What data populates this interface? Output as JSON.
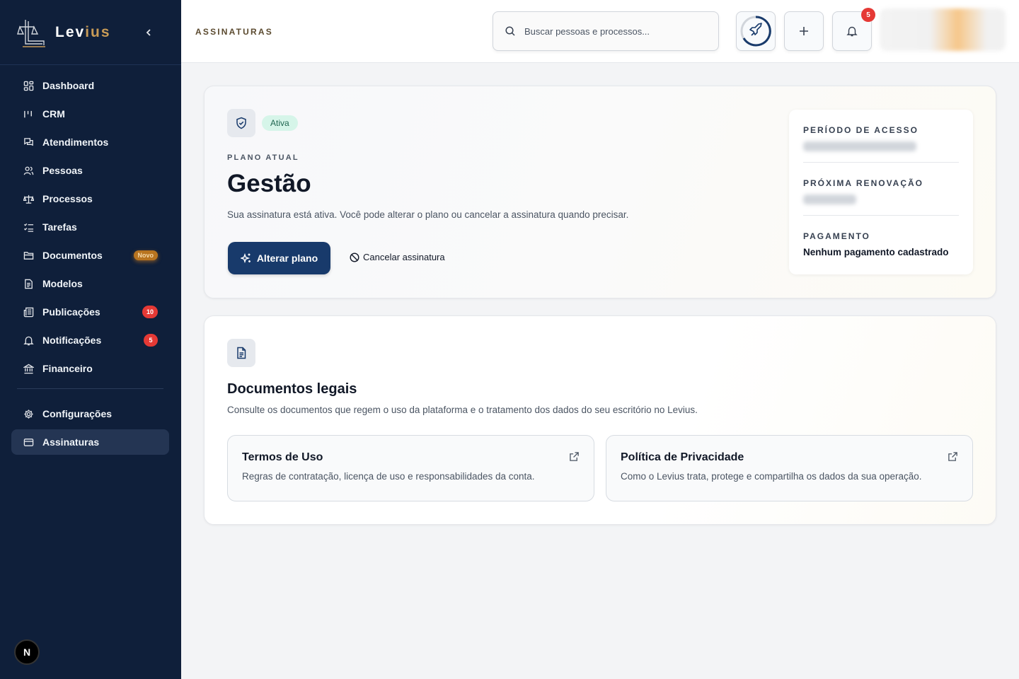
{
  "brand": {
    "name_main": "Lev",
    "name_accent": "ius"
  },
  "sidebar": {
    "items": [
      {
        "label": "Dashboard"
      },
      {
        "label": "CRM"
      },
      {
        "label": "Atendimentos"
      },
      {
        "label": "Pessoas"
      },
      {
        "label": "Processos"
      },
      {
        "label": "Tarefas"
      },
      {
        "label": "Documentos",
        "badge": "Novo"
      },
      {
        "label": "Modelos"
      },
      {
        "label": "Publicações",
        "badge": "10"
      },
      {
        "label": "Notificações",
        "badge": "5"
      },
      {
        "label": "Financeiro"
      }
    ],
    "bottom_items": [
      {
        "label": "Configurações"
      },
      {
        "label": "Assinaturas",
        "active": true
      }
    ],
    "user_initial": "N"
  },
  "topbar": {
    "breadcrumb": "ASSINATURAS",
    "search_placeholder": "Buscar pessoas e processos...",
    "notification_count": "5"
  },
  "subscription": {
    "status": "Ativa",
    "current_plan_label": "PLANO ATUAL",
    "plan_name": "Gestão",
    "description": "Sua assinatura está ativa. Você pode alterar o plano ou cancelar a assinatura quando precisar.",
    "change_plan_label": "Alterar plano",
    "cancel_label": "Cancelar assinatura",
    "access_period_label": "PERÍODO DE ACESSO",
    "renewal_label": "PRÓXIMA RENOVAÇÃO",
    "payment_label": "PAGAMENTO",
    "payment_value": "Nenhum pagamento cadastrado"
  },
  "legal": {
    "title": "Documentos legais",
    "description": "Consulte os documentos que regem o uso da plataforma e o tratamento dos dados do seu escritório no Levius.",
    "documents": [
      {
        "title": "Termos de Uso",
        "description": "Regras de contratação, licença de uso e responsabilidades da conta."
      },
      {
        "title": "Política de Privacidade",
        "description": "Como o Levius trata, protege e compartilha os dados da sua operação."
      }
    ]
  },
  "colors": {
    "sidebar_bg": "#0f1f3a",
    "primary": "#183a6b",
    "accent": "#c89b56",
    "badge_red": "#e53935",
    "status_green_bg": "#d6f5e9"
  },
  "icons": [
    "scales-logo-icon",
    "chevron-left-icon",
    "dashboard-icon",
    "crm-icon",
    "chat-icon",
    "users-icon",
    "scales-icon",
    "list-checks-icon",
    "folder-icon",
    "file-icon",
    "newspaper-icon",
    "bell-icon",
    "bank-icon",
    "gear-icon",
    "credit-card-icon",
    "search-icon",
    "rocket-icon",
    "plus-icon",
    "shield-check-icon",
    "sparkles-icon",
    "ban-icon",
    "document-icon",
    "external-link-icon"
  ]
}
